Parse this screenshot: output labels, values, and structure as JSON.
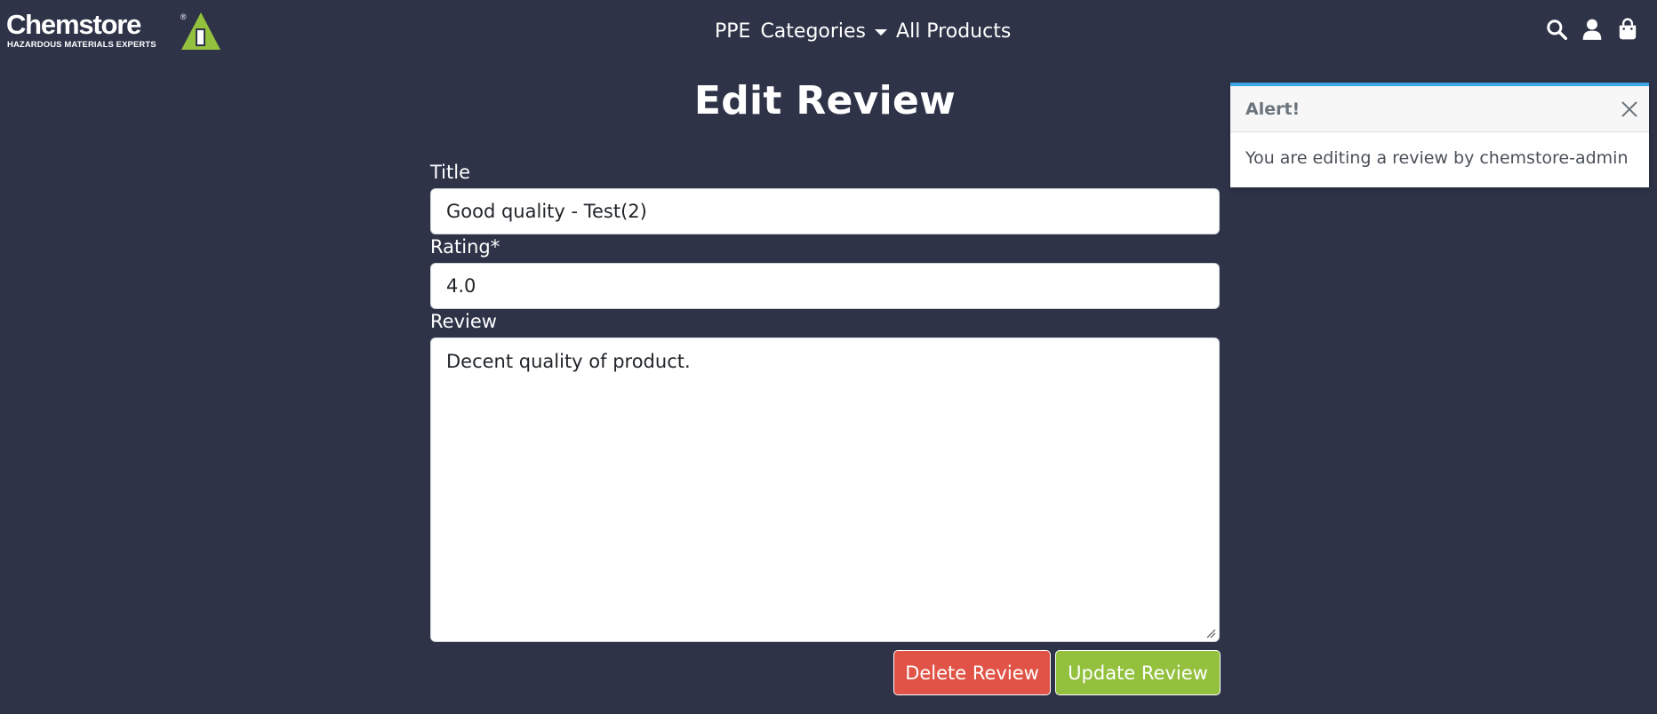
{
  "header": {
    "logo": {
      "wordmark": "Chemstore",
      "registered": "®",
      "tagline": "HAZARDOUS MATERIALS EXPERTS"
    },
    "nav": {
      "ppe": "PPE",
      "categories": "Categories",
      "all_products": "All Products"
    },
    "icons": [
      "search-icon",
      "account-icon",
      "shopping-bag-icon"
    ]
  },
  "page": {
    "title": "Edit Review"
  },
  "form": {
    "title_label": "Title",
    "title_value": "Good quality - Test(2)",
    "rating_label": "Rating*",
    "rating_value": "4.0",
    "review_label": "Review",
    "review_value": "Decent quality of product."
  },
  "buttons": {
    "delete": "Delete Review",
    "update": "Update Review"
  },
  "toast": {
    "title": "Alert!",
    "message": "You are editing a review by chemstore-admin"
  },
  "colors": {
    "background": "#2e3348",
    "brand_green": "#93c13e",
    "danger": "#e05346",
    "toast_accent": "#3aa6e8"
  }
}
